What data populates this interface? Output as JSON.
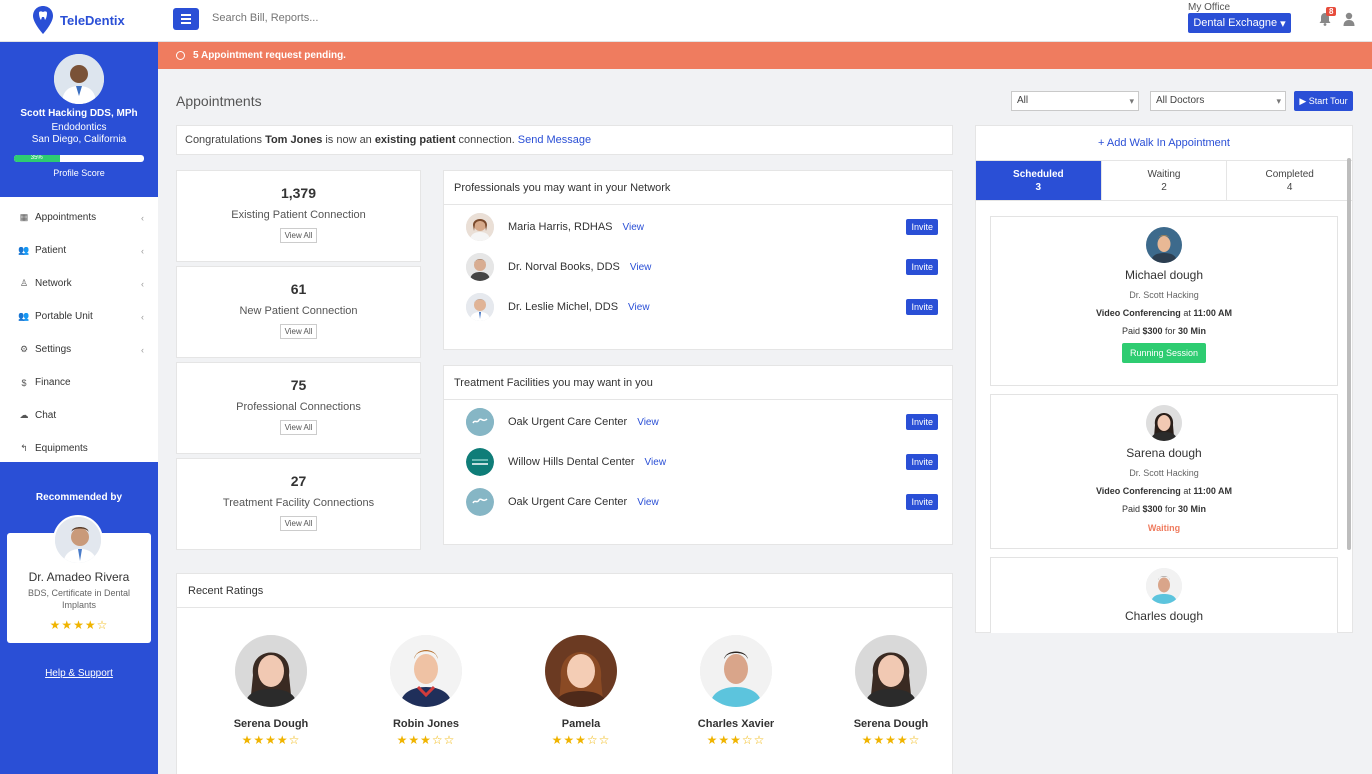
{
  "app": {
    "name": "TeleDentix",
    "search_placeholder": "Search Bill, Reports..."
  },
  "header": {
    "office_label": "My Office",
    "office_button": "Dental Exchagne",
    "notification_count": "8"
  },
  "profile": {
    "name": "Scott Hacking DDS, MPh",
    "specialty": "Endodontics",
    "location": "San Diego, California",
    "score_percent": "35%",
    "score_value": 0.35,
    "score_label": "Profile Score"
  },
  "nav": [
    {
      "label": "Appointments",
      "icon": "grid-icon"
    },
    {
      "label": "Patient",
      "icon": "users-icon"
    },
    {
      "label": "Network",
      "icon": "sitemap-icon"
    },
    {
      "label": "Portable Unit",
      "icon": "users-icon"
    },
    {
      "label": "Settings",
      "icon": "gear-icon"
    },
    {
      "label": "Finance",
      "icon": "dollar-icon"
    },
    {
      "label": "Chat",
      "icon": "chat-icon"
    },
    {
      "label": "Equipments",
      "icon": "reply-icon"
    }
  ],
  "recommended": {
    "title": "Recommended by",
    "name": "Dr. Amadeo Rivera",
    "degree": "BDS, Certificate in Dental Implants",
    "stars": "★★★★☆",
    "help": "Help & Support"
  },
  "alert": {
    "text": "5 Appointment request pending."
  },
  "page": {
    "title": "Appointments",
    "filter_status": "All",
    "filter_doctor": "All Doctors",
    "tour": "Start Tour"
  },
  "congrats": {
    "prefix": "Congratulations",
    "patient": "Tom Jones",
    "middle": "is now an",
    "type": "existing patient",
    "suffix": "connection.",
    "link": "Send Message"
  },
  "stats": [
    {
      "value": "1,379",
      "label": "Existing Patient Connection",
      "link": "View All"
    },
    {
      "value": "61",
      "label": "New Patient Connection",
      "link": "View All"
    },
    {
      "value": "75",
      "label": "Professional Connections",
      "link": "View All"
    },
    {
      "value": "27",
      "label": "Treatment Facility Connections",
      "link": "View All"
    }
  ],
  "professionals": {
    "title": "Professionals you may want in your Network",
    "items": [
      {
        "name": "Maria Harris, RDHAS",
        "view": "View",
        "invite": "Invite"
      },
      {
        "name": "Dr. Norval Books, DDS",
        "view": "View",
        "invite": "Invite"
      },
      {
        "name": "Dr. Leslie Michel, DDS",
        "view": "View",
        "invite": "Invite"
      }
    ]
  },
  "facilities": {
    "title": "Treatment Facilities you may want in you",
    "items": [
      {
        "name": "Oak Urgent Care Center",
        "view": "View",
        "invite": "Invite"
      },
      {
        "name": "Willow Hills Dental Center",
        "view": "View",
        "invite": "Invite"
      },
      {
        "name": "Oak Urgent Care Center",
        "view": "View",
        "invite": "Invite"
      }
    ]
  },
  "ratings": {
    "title": "Recent Ratings",
    "items": [
      {
        "name": "Serena Dough",
        "stars": "★★★★☆"
      },
      {
        "name": "Robin Jones",
        "stars": "★★★☆☆"
      },
      {
        "name": "Pamela",
        "stars": "★★★☆☆"
      },
      {
        "name": "Charles Xavier",
        "stars": "★★★☆☆"
      },
      {
        "name": "Serena Dough",
        "stars": "★★★★☆"
      }
    ]
  },
  "schedule": {
    "walkin": "+ Add Walk In Appointment",
    "tabs": [
      {
        "label": "Scheduled",
        "count": "3"
      },
      {
        "label": "Waiting",
        "count": "2"
      },
      {
        "label": "Completed",
        "count": "4"
      }
    ],
    "appointments": [
      {
        "name": "Michael dough",
        "doctor": "Dr. Scott Hacking",
        "mode": "Video Conferencing",
        "at": "at",
        "time": "11:00 AM",
        "paid": "Paid",
        "amount": "$300",
        "for": "for",
        "duration": "30 Min",
        "status": "Running Session"
      },
      {
        "name": "Sarena dough",
        "doctor": "Dr. Scott Hacking",
        "mode": "Video Conferencing",
        "at": "at",
        "time": "11:00 AM",
        "paid": "Paid",
        "amount": "$300",
        "for": "for",
        "duration": "30 Min",
        "status": "Waiting"
      },
      {
        "name": "Charles dough"
      }
    ]
  },
  "colors": {
    "brand": "#2a4fd6",
    "alert": "#ef7c5f",
    "success": "#2ecc71",
    "star": "#f0b400"
  }
}
